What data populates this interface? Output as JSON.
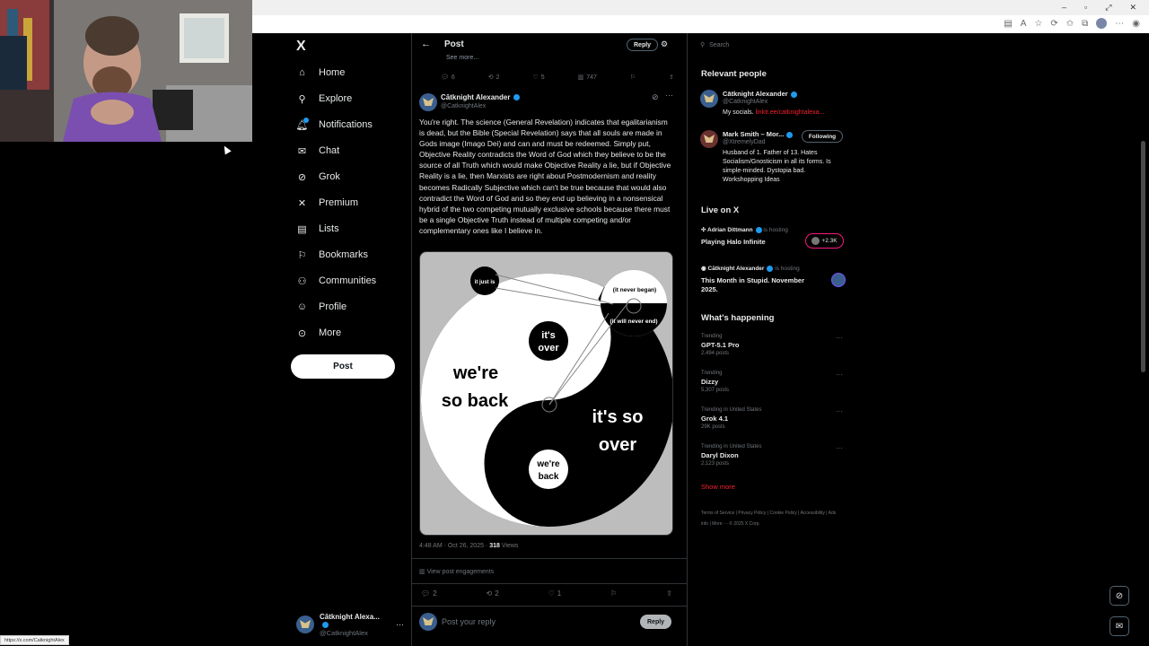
{
  "browser": {
    "window_controls": [
      "–",
      "▫",
      "⤢",
      "✕"
    ],
    "status_url": "https://x.com/CatknightAlex"
  },
  "nav": {
    "logo": "X",
    "items": [
      {
        "label": "Home",
        "icon": "home-icon"
      },
      {
        "label": "Explore",
        "icon": "search-icon"
      },
      {
        "label": "Notifications",
        "icon": "bell-icon"
      },
      {
        "label": "Chat",
        "icon": "envelope-icon"
      },
      {
        "label": "Grok",
        "icon": "grok-icon"
      },
      {
        "label": "Premium",
        "icon": "x-icon"
      },
      {
        "label": "Lists",
        "icon": "list-icon"
      },
      {
        "label": "Bookmarks",
        "icon": "bookmark-icon"
      },
      {
        "label": "Communities",
        "icon": "people-icon"
      },
      {
        "label": "Profile",
        "icon": "person-icon"
      },
      {
        "label": "More",
        "icon": "more-circle-icon"
      }
    ],
    "post_label": "Post",
    "account": {
      "name": "Cātknight Alexa...",
      "handle": "@CatknightAlex"
    }
  },
  "main": {
    "title": "Post",
    "reply_label": "Reply",
    "see_more": "See more...",
    "parent_actions": {
      "replies": "6",
      "reposts": "2",
      "likes": "5",
      "views": "747"
    },
    "tweet": {
      "author": "Cātknight Alexander",
      "handle": "@CatknightAlex",
      "text": "You're right. The science (General Revelation) indicates that egalitarianism is dead, but the Bible (Special Revelation) says that all souls are made in Gods image (Imago Dei) and can and must be redeemed. Simply put, Objective Reality contradicts the Word of God which they believe to be the source of all Truth which would make Objective Reality a lie, but if Objective Reality is a lie, then Marxists are right about Postmodernism and reality becomes Radically Subjective which can't be true because that would also contradict the Word of God and so they end up believing in a nonsensical hybrid of the two competing mutually exclusive schools because there must be a single Objective Truth instead of multiple competing and/or complementary ones like I believe in.",
      "meme": {
        "it_just_is": "it just is",
        "never_began": "(it never began)",
        "never_end": "(it will never end)",
        "its_over_1": "it's",
        "its_over_2": "over",
        "so_back_1": "we're",
        "so_back_2": "so back",
        "so_over_1": "it's so",
        "so_over_2": "over",
        "back_1": "we're",
        "back_2": "back"
      },
      "time": "4:48 AM · Oct 26, 2025 · ",
      "views_count": "318",
      "views_label": " Views",
      "engagements": "View post engagements",
      "actions": {
        "replies": "2",
        "reposts": "2",
        "likes": "1"
      }
    },
    "reply_placeholder": "Post your reply",
    "reply_button": "Reply"
  },
  "right": {
    "search_placeholder": "Search",
    "relevant_title": "Relevant people",
    "people": [
      {
        "name": "Cātknight Alexander",
        "handle": "@CatknightAlex",
        "bio_prefix": "My socials. ",
        "bio_link": "linktr.ee/catknightalexa..."
      },
      {
        "name": "Mark Smith – Mor...",
        "handle": "@XtremelyDad",
        "bio": "Husband of 1. Father of 13. Hates Socialism/Gnosticism in all its forms. Is simple-minded. Dystopia bad. Workshopping Ideas",
        "follow_label": "Following"
      }
    ],
    "live_title": "Live on X",
    "live": [
      {
        "host": "Adrian Dittmann",
        "status": " is hosting",
        "title": "Playing Halo Infinite",
        "badge": "+2.3K"
      },
      {
        "host": "Cātknight Alexander",
        "status": " is hosting",
        "title": "This Month in Stupid. November 2025."
      }
    ],
    "happening_title": "What's happening",
    "trends": [
      {
        "context": "Trending",
        "name": "GPT-5.1 Pro",
        "count": "2,494 posts"
      },
      {
        "context": "Trending",
        "name": "Dizzy",
        "count": "5,307 posts"
      },
      {
        "context": "Trending in United States",
        "name": "Grok 4.1",
        "count": "29K posts"
      },
      {
        "context": "Trending in United States",
        "name": "Daryl Dixon",
        "count": "2,123 posts"
      }
    ],
    "show_more": "Show more",
    "footer": "Terms of Service  |  Privacy Policy  |  Cookie Policy  |  Accessibility  |  Ads info  |  More ···  © 2025 X Corp."
  }
}
